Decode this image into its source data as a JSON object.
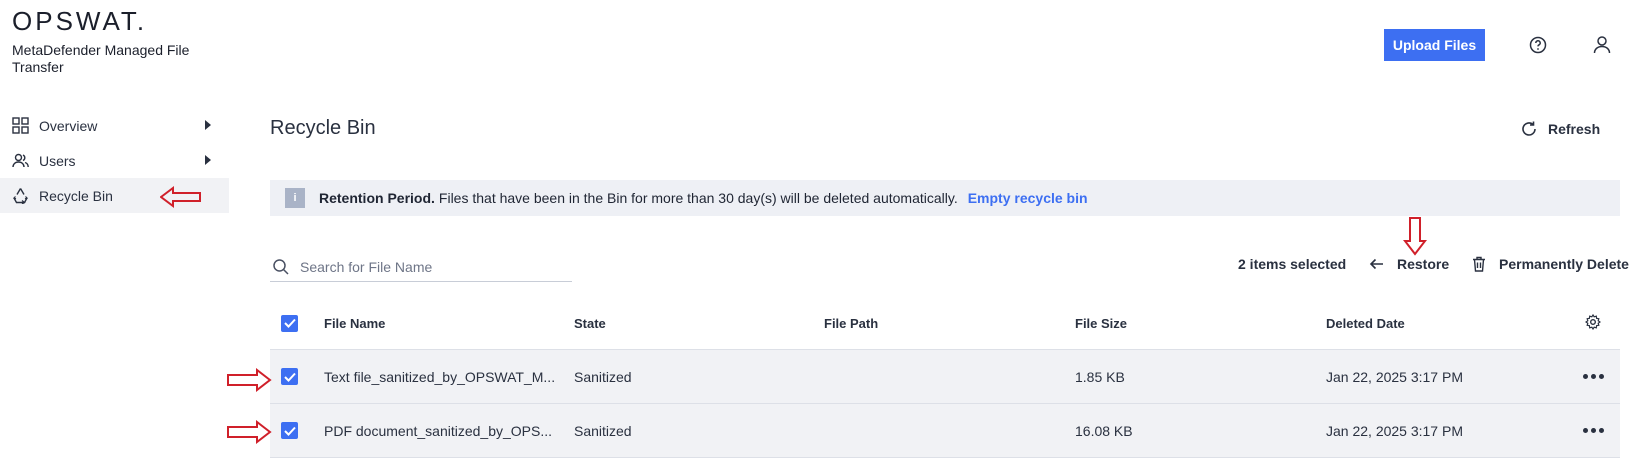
{
  "brand": {
    "logo": "OPSWAT.",
    "product": "MetaDefender Managed File Transfer"
  },
  "header": {
    "upload_label": "Upload Files",
    "help_icon": "help-circle-icon",
    "user_icon": "user-icon"
  },
  "sidebar": {
    "items": [
      {
        "label": "Overview",
        "icon": "grid-icon",
        "expandable": true
      },
      {
        "label": "Users",
        "icon": "users-icon",
        "expandable": true
      },
      {
        "label": "Recycle Bin",
        "icon": "recycle-icon",
        "active": true
      }
    ]
  },
  "main": {
    "title": "Recycle Bin",
    "refresh_label": "Refresh",
    "banner": {
      "bold": "Retention Period.",
      "text": "Files that have been in the Bin for more than 30 day(s) will be deleted automatically.",
      "link": "Empty recycle bin"
    },
    "search": {
      "placeholder": "Search for File Name"
    },
    "selected_count": "2 items selected",
    "restore_label": "Restore",
    "perm_delete_label": "Permanently Delete"
  },
  "table": {
    "columns": [
      "File Name",
      "State",
      "File Path",
      "File Size",
      "Deleted Date"
    ],
    "rows": [
      {
        "checked": true,
        "name": "Text file_sanitized_by_OPSWAT_M...",
        "state": "Sanitized",
        "path": "",
        "size": "1.85 KB",
        "date": "Jan 22, 2025 3:17 PM"
      },
      {
        "checked": true,
        "name": "PDF document_sanitized_by_OPS...",
        "state": "Sanitized",
        "path": "",
        "size": "16.08 KB",
        "date": "Jan 22, 2025 3:17 PM"
      }
    ]
  },
  "colors": {
    "accent": "#3d6ff2",
    "annotation": "#d0202a"
  }
}
